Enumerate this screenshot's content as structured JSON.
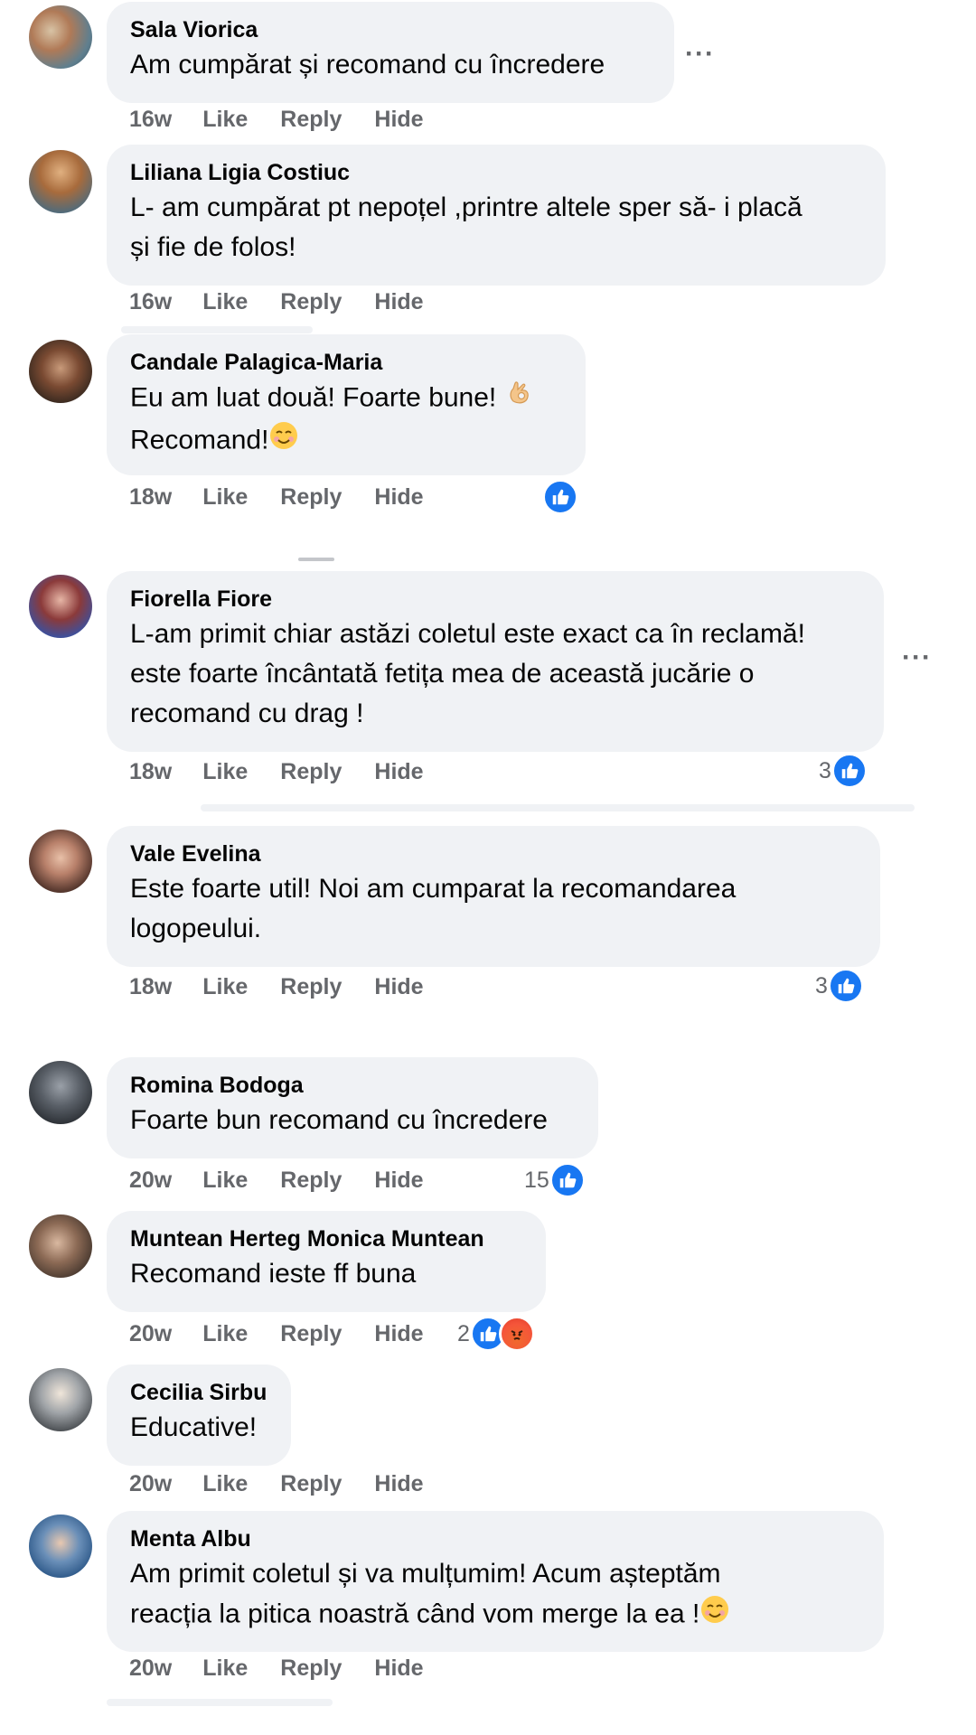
{
  "colors": {
    "bubble": "#f0f2f5",
    "action_text": "#65676b",
    "like_blue": "#1877f2"
  },
  "labels": {
    "like": "Like",
    "reply": "Reply",
    "hide": "Hide",
    "more": "···"
  },
  "comments": [
    {
      "author": "Sala Viorica",
      "lines": [
        "Am cumpărat și recomand cu încredere"
      ],
      "time": "16w"
    },
    {
      "author": "Liliana Ligia Costiuc",
      "lines": [
        "L- am cumpărat pt nepoțel ,printre altele sper să- i placă",
        "și fie de folos!"
      ],
      "time": "16w"
    },
    {
      "author": "Candale Palagica-Maria",
      "lines": [
        "Eu am luat două! Foarte bune!",
        "Recomand!"
      ],
      "time": "18w",
      "emoji_1": "ok-hand-emoji",
      "emoji_2": "smiling-face-emoji"
    },
    {
      "author": "Fiorella Fiore",
      "lines": [
        "L-am primit chiar astăzi coletul este exact ca în reclamă!",
        "este foarte încântată fetița mea de această jucărie o",
        "recomand cu drag !"
      ],
      "time": "18w",
      "reactions": "3"
    },
    {
      "author": "Vale Evelina",
      "lines": [
        "Este foarte util! Noi am cumparat la recomandarea",
        "logopeului."
      ],
      "time": "18w",
      "reactions": "3"
    },
    {
      "author": "Romina Bodoga",
      "lines": [
        "Foarte bun recomand cu încredere"
      ],
      "time": "20w",
      "reactions": "15"
    },
    {
      "author": "Muntean Herteg Monica Muntean",
      "lines": [
        "Recomand ieste ff buna"
      ],
      "time": "20w",
      "reactions": "2"
    },
    {
      "author": "Cecilia Sirbu",
      "lines": [
        "Educative!"
      ],
      "time": "20w"
    },
    {
      "author": "Menta Albu",
      "lines": [
        "Am primit coletul și va mulțumim! Acum așteptăm",
        "reacția la pitica noastră când vom merge la ea !"
      ],
      "time": "20w",
      "emoji_2": "smiling-face-emoji"
    }
  ]
}
